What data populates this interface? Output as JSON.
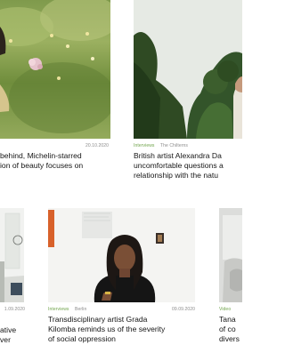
{
  "articles": [
    {
      "date": "20.10.2020",
      "title_lines": [
        " behind, Michelin-starred",
        "ion of beauty focuses on"
      ]
    },
    {
      "category": "Interviews",
      "location": "The Chilterns",
      "title_lines": [
        "British artist Alexandra Da",
        "uncomfortable questions a",
        "relationship with the natu"
      ]
    },
    {
      "date": "1.09.2020",
      "title_lines": [
        "ative",
        "ver"
      ]
    },
    {
      "category": "Interviews",
      "location": "Berlin",
      "date": "09.09.2020",
      "title_lines": [
        "Transdisciplinary artist Grada",
        "Kilomba reminds us of the severity",
        "of social oppression"
      ]
    },
    {
      "category": "Video",
      "title_lines": [
        "Tana",
        "of co",
        "divers"
      ]
    }
  ],
  "colors": {
    "category_green": "#6fa34a",
    "meta_grey": "#8a8a8a",
    "text": "#161616"
  }
}
